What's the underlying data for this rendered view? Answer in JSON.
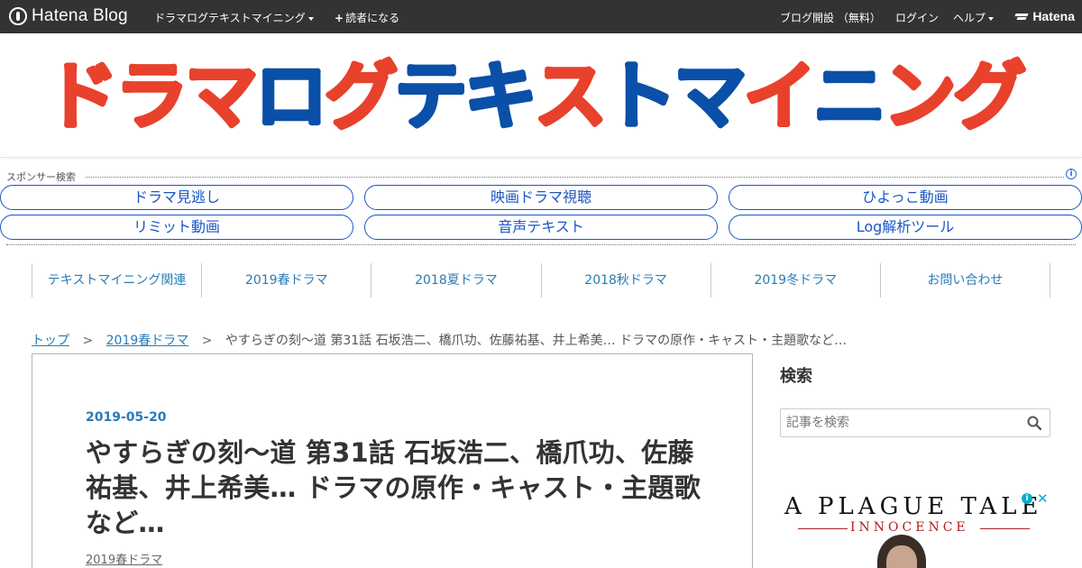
{
  "topbar": {
    "brand": "Hatena Blog",
    "blog_menu": "ドラマログテキストマイニング",
    "subscribe": "読者になる",
    "open_blog": "ブログ開設 （無料）",
    "login": "ログイン",
    "help": "ヘルプ",
    "hatena": "Hatena"
  },
  "header": {
    "logo_text": "ドラマログテキストマイニング",
    "logo_colors": [
      "#e8412c",
      "#0a4fa8"
    ]
  },
  "sponsor": {
    "label": "スポンサー検索",
    "info_icon": "i",
    "links": [
      "ドラマ見逃し",
      "映画ドラマ視聴",
      "ひよっこ動画",
      "リミット動画",
      "音声テキスト",
      "Log解析ツール"
    ]
  },
  "categories": [
    "テキストマイニング関連",
    "2019春ドラマ",
    "2018夏ドラマ",
    "2018秋ドラマ",
    "2019冬ドラマ",
    "お問い合わせ"
  ],
  "breadcrumb": {
    "top": "トップ",
    "sep": ">",
    "category": "2019春ドラマ",
    "current": "やすらぎの刻～道 第31話 石坂浩二、橋爪功、佐藤祐基、井上希美… ドラマの原作・キャスト・主題歌など…"
  },
  "article": {
    "date": "2019-05-20",
    "title": "やすらぎの刻～道 第31話 石坂浩二、橋爪功、佐藤祐基、井上希美… ドラマの原作・キャスト・主題歌など…",
    "category": "2019春ドラマ"
  },
  "sidebar": {
    "search_heading": "検索",
    "search_placeholder": "記事を検索",
    "ad_title": "A PLAGUE TALE",
    "ad_subtitle": "INNOCENCE",
    "adchoices_icon": "i",
    "ad_close": "✕"
  }
}
